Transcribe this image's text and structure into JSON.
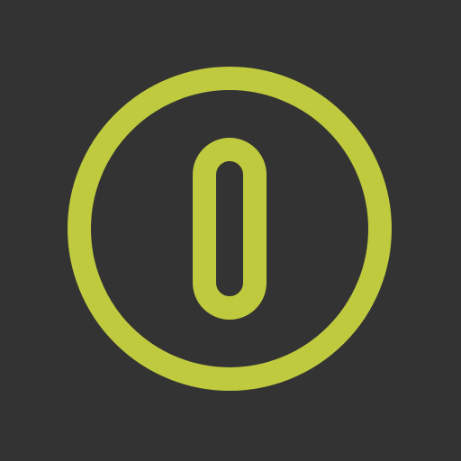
{
  "icon": {
    "name": "power-icon",
    "accent_color": "#bfca3e",
    "background_color": "#333333"
  }
}
